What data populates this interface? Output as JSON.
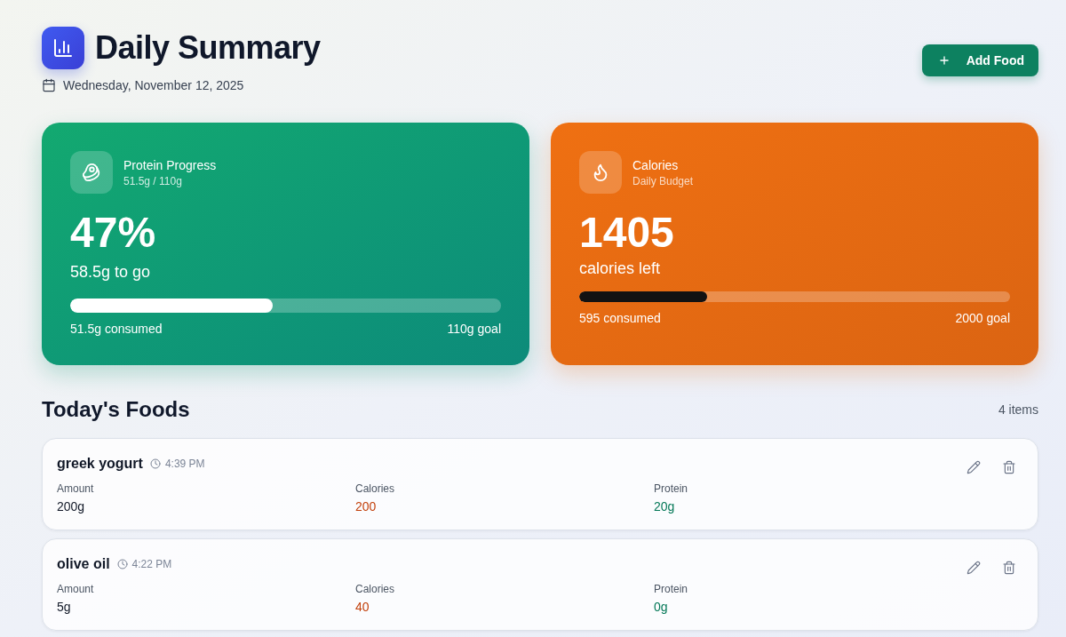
{
  "header": {
    "title": "Daily Summary",
    "date": "Wednesday, November 12, 2025",
    "add_button": "Add Food"
  },
  "cards": [
    {
      "kind": "protein",
      "title": "Protein Progress",
      "subtitle": "51.5g / 110g",
      "value": "47%",
      "caption": "58.5g to go",
      "level": 0.47,
      "consumed": "51.5g consumed",
      "goal": "110g goal"
    },
    {
      "kind": "calories",
      "title": "Calories",
      "subtitle": "Daily Budget",
      "value": "1405",
      "caption": "calories left",
      "level": 0.2975,
      "consumed": "595 consumed",
      "goal": "2000 goal"
    }
  ],
  "foods": {
    "title": "Today's Foods",
    "count": "4 items",
    "items": [
      {
        "name": "greek yogurt",
        "time": "4:39 PM",
        "fields": [
          {
            "kind": "amount",
            "label": "Amount",
            "value": "200g"
          },
          {
            "kind": "calories",
            "label": "Calories",
            "value": "200"
          },
          {
            "kind": "protein",
            "label": "Protein",
            "value": "20g"
          }
        ]
      },
      {
        "name": "olive oil",
        "time": "4:22 PM",
        "fields": [
          {
            "kind": "amount",
            "label": "Amount",
            "value": "5g"
          },
          {
            "kind": "calories",
            "label": "Calories",
            "value": "40"
          },
          {
            "kind": "protein",
            "label": "Protein",
            "value": "0g"
          }
        ]
      }
    ]
  }
}
